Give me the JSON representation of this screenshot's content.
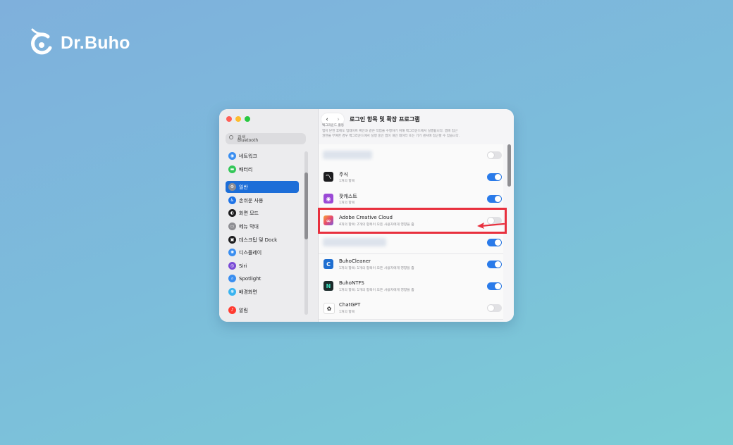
{
  "brand": {
    "name": "Dr.Buho"
  },
  "window": {
    "lights": [
      "#ff5f57",
      "#febc2e",
      "#28c840"
    ],
    "search": {
      "label": "검색",
      "overlap_text": "Bluetooth"
    },
    "sidebar": [
      {
        "label": "네트워크",
        "icon": "globe-icon",
        "color": "#3a8ef0"
      },
      {
        "label": "배터리",
        "icon": "battery-icon",
        "color": "#34c759"
      },
      {
        "label": "일반",
        "icon": "gear-icon",
        "color": "#8e8e93",
        "active": true
      },
      {
        "label": "손쉬운 사용",
        "icon": "accessibility-icon",
        "color": "#1d73e8"
      },
      {
        "label": "화면 모드",
        "icon": "appearance-icon",
        "color": "#1c1c1e"
      },
      {
        "label": "메뉴 막대",
        "icon": "menubar-icon",
        "color": "#8e8e93"
      },
      {
        "label": "데스크탑 및 Dock",
        "icon": "dock-icon",
        "color": "#1c1c1e"
      },
      {
        "label": "디스플레이",
        "icon": "display-icon",
        "color": "#3a8ef0"
      },
      {
        "label": "Siri",
        "icon": "siri-icon",
        "color": "#7a4bd6"
      },
      {
        "label": "Spotlight",
        "icon": "spotlight-icon",
        "color": "#3a8ef0"
      },
      {
        "label": "배경화면",
        "icon": "wallpaper-icon",
        "color": "#3ab4f0"
      },
      {
        "label": "알림",
        "icon": "bell-icon",
        "color": "#ff3b30"
      }
    ],
    "main": {
      "nav_back": "‹",
      "nav_forward": "›",
      "title": "로그인 항목 및 확장 프로그램",
      "section_label": "백그라운드 활동",
      "desc_lines": [
        "앱이 닫힌 후에도 업데이트 확인과 같은 작업을 수행하기 위해 백그라운드에서 실행됩니다. 앱에 접근",
        "권한을 부여한 경우 백그라운드에서 실행 중인 앱이 개인 데이터 또는 기기 센서에 접근할 수 있습니다."
      ],
      "rows": [
        {
          "name": "주식",
          "sub": "1개의 항목",
          "on": true,
          "icon": "stocks-icon",
          "icon_color": "#1c1c1e"
        },
        {
          "name": "팟캐스트",
          "sub": "1개의 항목",
          "on": true,
          "icon": "podcasts-icon",
          "icon_color": "#9b4ad6"
        },
        {
          "name": "Adobe Creative Cloud",
          "sub": "4개의 항목: 2개의 항목이 모든 사용자에게 영향을 줌",
          "on": false,
          "icon": "creative-cloud-icon",
          "icon_color": "#e94b6a"
        },
        {
          "name": "BuhoCleaner",
          "sub": "1개의 항목: 1개의 항목이 모든 사용자에게 영향을 줌",
          "on": true,
          "icon": "buhocleaner-icon",
          "icon_color": "#1f6fd1"
        },
        {
          "name": "BuhoNTFS",
          "sub": "1개의 항목: 1개의 항목이 모든 사용자에게 영향을 줌",
          "on": true,
          "icon": "buhontfs-icon",
          "icon_color": "#1c2b2b"
        },
        {
          "name": "ChatGPT",
          "sub": "1개의 항목",
          "on": false,
          "icon": "chatgpt-icon",
          "icon_color": "#ffffff"
        }
      ]
    }
  },
  "annotation": {
    "highlight_color": "#e8303e"
  }
}
